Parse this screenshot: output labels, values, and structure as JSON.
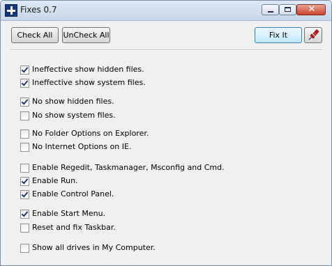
{
  "window": {
    "title": "Fixes 0.7",
    "close_glyph": "✕",
    "icon": "blue-cross-app-icon"
  },
  "toolbar": {
    "check_all": "Check All",
    "uncheck_all": "UnCheck All",
    "fix_it": "Fix It",
    "pin_icon": "red-pushpin-icon"
  },
  "colors": {
    "title_gradient_top": "#dfe9f5",
    "close_button": "#c8452f",
    "fix_it_accent": "#3c7fb1",
    "check_color": "#1f3a70"
  },
  "options": [
    {
      "label": "Ineffective show hidden files.",
      "checked": true
    },
    {
      "label": "Ineffective show system files.",
      "checked": true
    },
    {
      "label": "No show hidden files.",
      "checked": true
    },
    {
      "label": "No show system files.",
      "checked": false
    },
    {
      "label": "No Folder Options on Explorer.",
      "checked": false
    },
    {
      "label": "No Internet Options on IE.",
      "checked": false
    },
    {
      "label": "Enable Regedit, Taskmanager, Msconfig and Cmd.",
      "checked": false
    },
    {
      "label": "Enable Run.",
      "checked": true
    },
    {
      "label": "Enable Control Panel.",
      "checked": true
    },
    {
      "label": "Enable Start Menu.",
      "checked": true
    },
    {
      "label": "Reset and fix Taskbar.",
      "checked": false
    },
    {
      "label": "Show all drives in My Computer.",
      "checked": false
    }
  ]
}
